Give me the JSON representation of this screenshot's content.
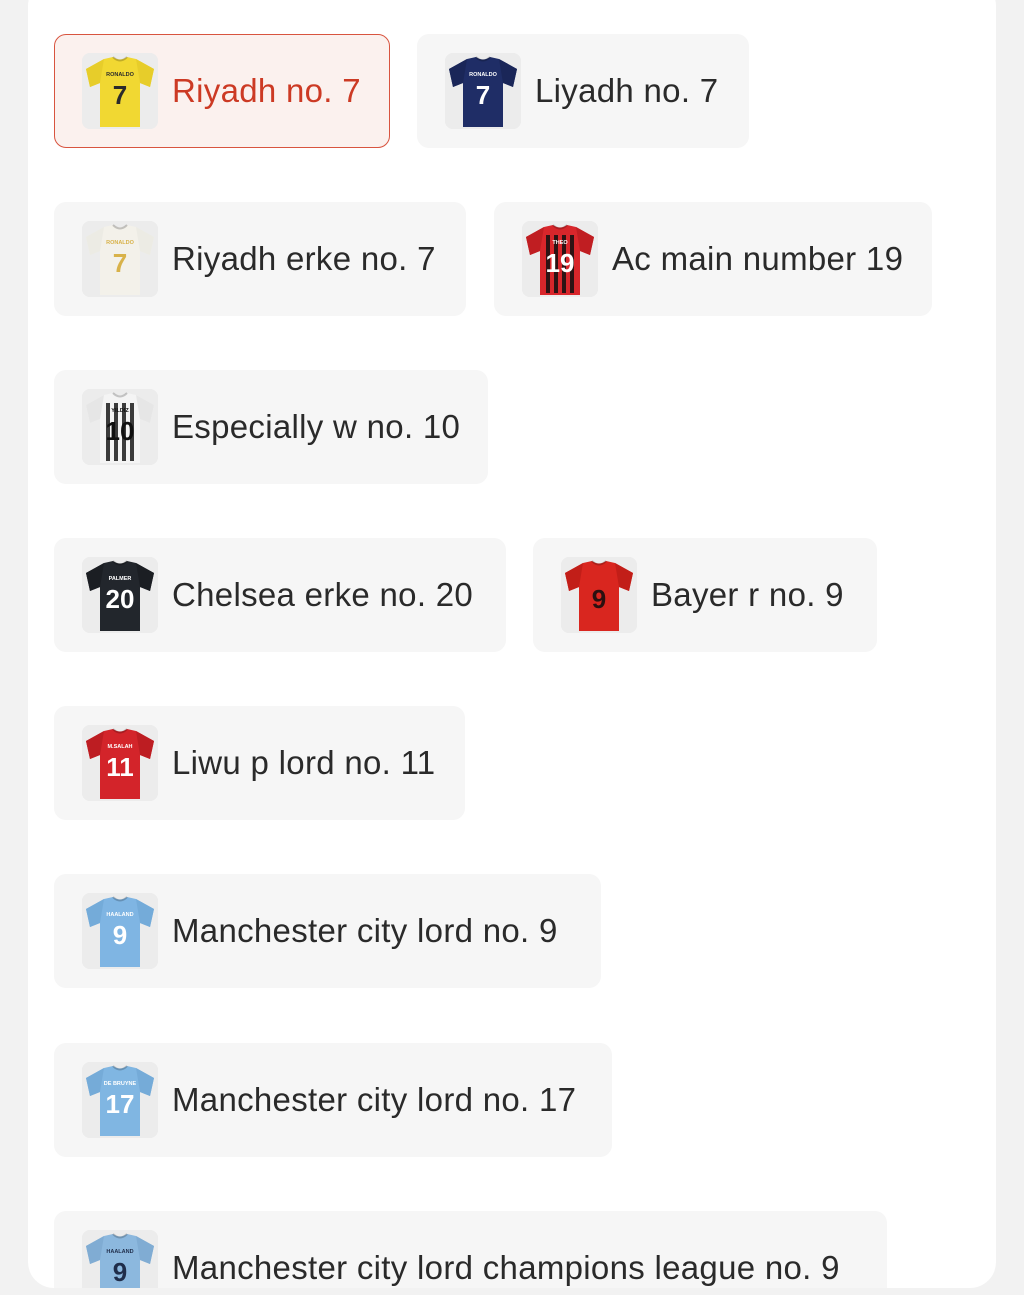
{
  "options": [
    {
      "label": "Riyadh no. 7",
      "selected": true,
      "icon": "yellow-jersey-icon",
      "jersey": {
        "body": "#f1d832",
        "sleeve": "#e7cd2a",
        "number": "7",
        "numColor": "#2b2b2b",
        "name": "RONALDO",
        "stripe": ""
      }
    },
    {
      "label": "Liyadh no. 7",
      "selected": false,
      "icon": "navy-jersey-icon",
      "jersey": {
        "body": "#1f2d66",
        "sleeve": "#1a2658",
        "number": "7",
        "numColor": "#ffffff",
        "name": "RONALDO",
        "stripe": ""
      }
    },
    {
      "label": "Riyadh erke no. 7",
      "selected": false,
      "icon": "white-jersey-icon",
      "jersey": {
        "body": "#f3f1ea",
        "sleeve": "#ecebe4",
        "number": "7",
        "numColor": "#d8b24a",
        "name": "RONALDO",
        "stripe": ""
      }
    },
    {
      "label": "Ac main number 19",
      "selected": false,
      "icon": "red-black-jersey-icon",
      "jersey": {
        "body": "#d8262b",
        "sleeve": "#c01e22",
        "number": "19",
        "numColor": "#ffffff",
        "name": "THEO",
        "stripe": "#111111"
      }
    },
    {
      "label": "Especially w no. 10",
      "selected": false,
      "icon": "black-white-jersey-icon",
      "jersey": {
        "body": "#f4f4f4",
        "sleeve": "#e6e6e6",
        "number": "10",
        "numColor": "#111111",
        "name": "YILDIZ",
        "stripe": "#1a1a1a"
      }
    },
    {
      "label": "Chelsea erke no. 20",
      "selected": false,
      "icon": "dark-jersey-icon",
      "jersey": {
        "body": "#22262c",
        "sleeve": "#1b1e23",
        "number": "20",
        "numColor": "#ffffff",
        "name": "PALMER",
        "stripe": ""
      }
    },
    {
      "label": "Bayer r no. 9",
      "selected": false,
      "icon": "red-jersey-icon",
      "jersey": {
        "body": "#d9261f",
        "sleeve": "#c21e18",
        "number": "9",
        "numColor": "#2b1010",
        "name": "",
        "stripe": ""
      }
    },
    {
      "label": "Liwu p lord no. 11",
      "selected": false,
      "icon": "red-jersey-icon",
      "jersey": {
        "body": "#d3242a",
        "sleeve": "#bd1d22",
        "number": "11",
        "numColor": "#ffffff",
        "name": "M.SALAH",
        "stripe": ""
      }
    },
    {
      "label": "Manchester city lord no. 9",
      "selected": false,
      "icon": "sky-blue-jersey-icon",
      "jersey": {
        "body": "#7fb5e3",
        "sleeve": "#74abd9",
        "number": "9",
        "numColor": "#ffffff",
        "name": "HAALAND",
        "stripe": ""
      }
    },
    {
      "label": "Manchester city lord no. 17",
      "selected": false,
      "icon": "sky-blue-jersey-icon",
      "jersey": {
        "body": "#80b6e2",
        "sleeve": "#75abd8",
        "number": "17",
        "numColor": "#ffffff",
        "name": "DE BRUYNE",
        "stripe": ""
      }
    },
    {
      "label": "Manchester city lord champions league no. 9",
      "selected": false,
      "icon": "sky-blue-jersey-icon",
      "jersey": {
        "body": "#8cb8de",
        "sleeve": "#80acd3",
        "number": "9",
        "numColor": "#1f2d4a",
        "name": "HAALAND",
        "stripe": ""
      }
    }
  ],
  "colors": {
    "selected_text": "#cc3a24",
    "selected_border": "#d8543f",
    "selected_bg": "#fbf1ee",
    "chip_bg": "#f6f6f6"
  }
}
